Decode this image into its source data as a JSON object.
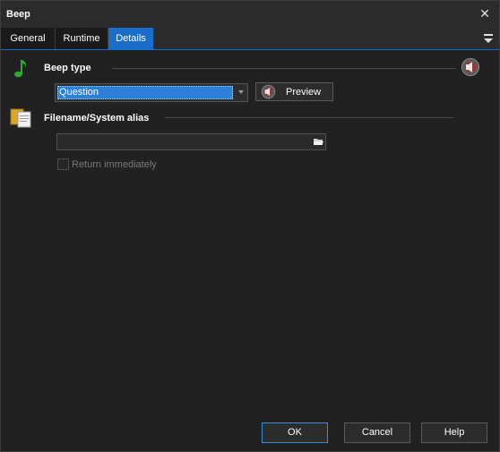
{
  "window": {
    "title": "Beep",
    "close_glyph": "✕"
  },
  "tabs": [
    {
      "label": "General",
      "active": false
    },
    {
      "label": "Runtime",
      "active": false
    },
    {
      "label": "Details",
      "active": true
    }
  ],
  "beep_type": {
    "heading": "Beep type",
    "selected": "Question",
    "preview_label": "Preview"
  },
  "filename": {
    "heading": "Filename/System alias",
    "value": ""
  },
  "return_immediately": {
    "label": "Return immediately",
    "checked": false,
    "enabled": false
  },
  "footer": {
    "ok": "OK",
    "cancel": "Cancel",
    "help": "Help"
  },
  "icons": {
    "beep_type": "music-note-icon",
    "speaker": "speaker-mute-icon",
    "filename": "file-copy-icon",
    "browse": "folder-open-icon",
    "menu": "menu-dropdown-icon"
  },
  "colors": {
    "accent": "#1a6ec9",
    "background": "#212121",
    "note_green": "#2ea82e"
  }
}
